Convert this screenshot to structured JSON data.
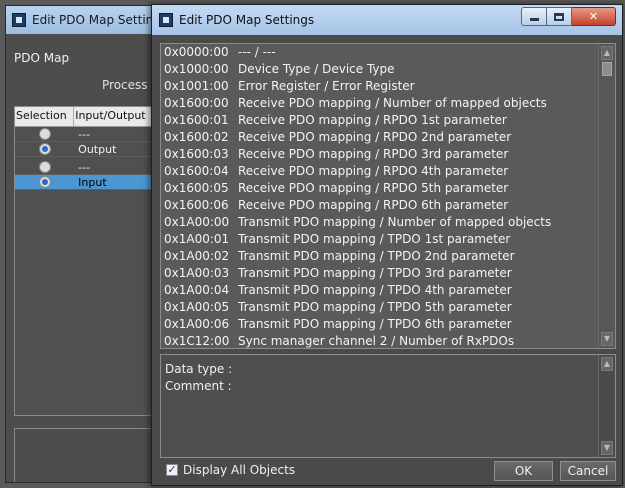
{
  "background_dialog": {
    "title": "Edit PDO Map Settings",
    "pdo_map_label": "PDO Map",
    "process_label": "Process D",
    "columns": [
      "Selection",
      "Input/Output"
    ],
    "rows": [
      {
        "selected": false,
        "value": "---"
      },
      {
        "selected": true,
        "value": "Output"
      },
      {
        "selected": false,
        "value": "---"
      },
      {
        "selected": true,
        "value": "Input"
      }
    ]
  },
  "dialog": {
    "title": "Edit PDO Map Settings",
    "objects": [
      {
        "index": "0x0000:00",
        "name": "--- / ---"
      },
      {
        "index": "0x1000:00",
        "name": "Device Type / Device Type"
      },
      {
        "index": "0x1001:00",
        "name": "Error Register / Error Register"
      },
      {
        "index": "0x1600:00",
        "name": "Receive PDO mapping / Number of mapped objects"
      },
      {
        "index": "0x1600:01",
        "name": "Receive PDO mapping / RPDO 1st parameter"
      },
      {
        "index": "0x1600:02",
        "name": "Receive PDO mapping / RPDO 2nd parameter"
      },
      {
        "index": "0x1600:03",
        "name": "Receive PDO mapping / RPDO 3rd parameter"
      },
      {
        "index": "0x1600:04",
        "name": "Receive PDO mapping / RPDO 4th parameter"
      },
      {
        "index": "0x1600:05",
        "name": "Receive PDO mapping / RPDO 5th parameter"
      },
      {
        "index": "0x1600:06",
        "name": "Receive PDO mapping / RPDO 6th parameter"
      },
      {
        "index": "0x1A00:00",
        "name": "Transmit PDO mapping / Number of mapped objects"
      },
      {
        "index": "0x1A00:01",
        "name": "Transmit PDO mapping / TPDO 1st parameter"
      },
      {
        "index": "0x1A00:02",
        "name": "Transmit PDO mapping / TPDO 2nd parameter"
      },
      {
        "index": "0x1A00:03",
        "name": "Transmit PDO mapping / TPDO 3rd parameter"
      },
      {
        "index": "0x1A00:04",
        "name": "Transmit PDO mapping / TPDO 4th parameter"
      },
      {
        "index": "0x1A00:05",
        "name": "Transmit PDO mapping / TPDO 5th parameter"
      },
      {
        "index": "0x1A00:06",
        "name": "Transmit PDO mapping / TPDO 6th parameter"
      },
      {
        "index": "0x1C12:00",
        "name": "Sync manager channel 2 / Number of RxPDOs"
      }
    ],
    "data_type_label": "Data type :",
    "comment_label": "Comment :",
    "display_all_label": "Display All Objects",
    "display_all_checked": true,
    "ok_label": "OK",
    "cancel_label": "Cancel"
  }
}
